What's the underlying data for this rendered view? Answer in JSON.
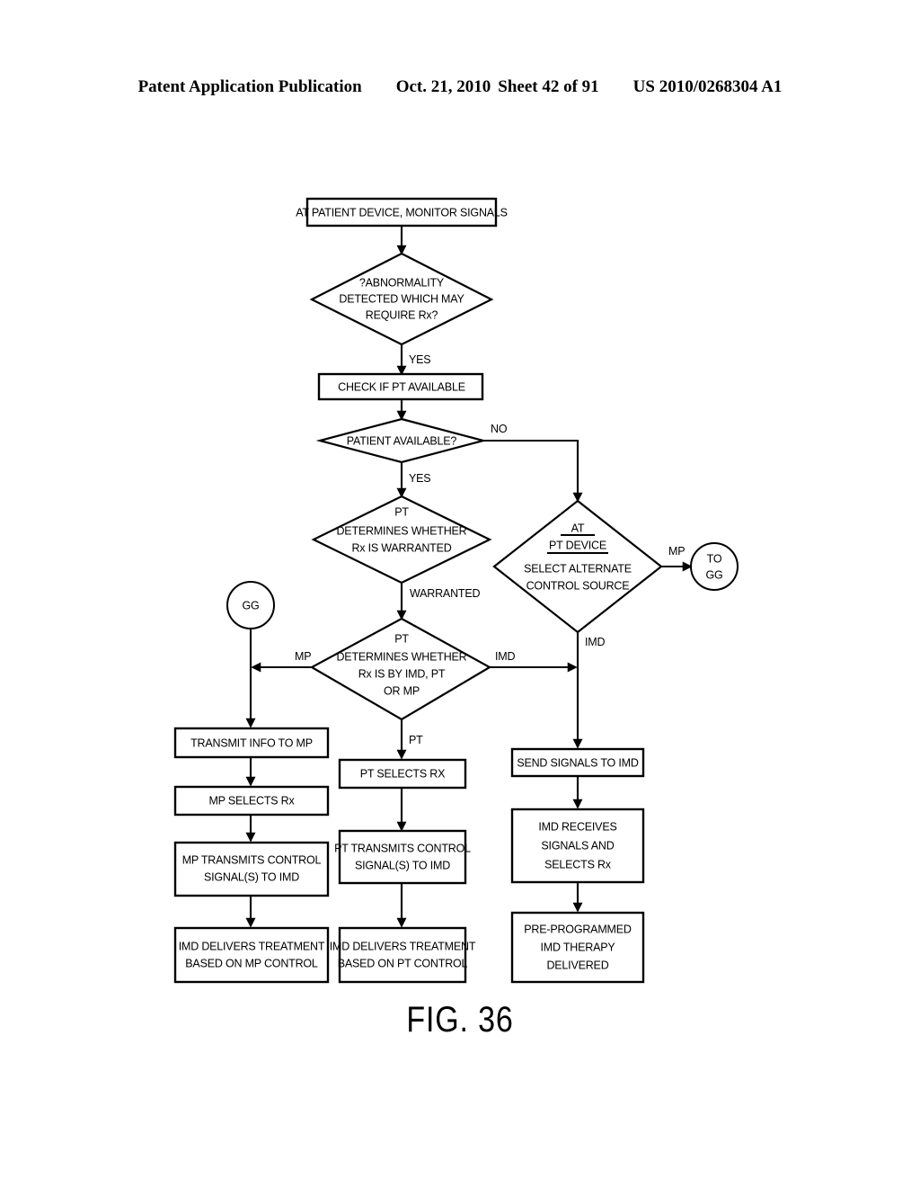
{
  "header": {
    "publication": "Patent Application Publication",
    "date": "Oct. 21, 2010",
    "sheet": "Sheet 42 of 91",
    "number": "US 2010/0268304 A1"
  },
  "figure": {
    "caption": "FIG. 36"
  },
  "flowchart": {
    "nodes": {
      "monitor": {
        "type": "process",
        "text": [
          "AT PATIENT DEVICE, MONITOR SIGNALS"
        ]
      },
      "abnormality": {
        "type": "decision",
        "text": [
          "?ABNORMALITY",
          "DETECTED WHICH MAY",
          "REQUIRE Rx?"
        ]
      },
      "check_pt": {
        "type": "process",
        "text": [
          "CHECK IF PT AVAILABLE"
        ]
      },
      "patient_available": {
        "type": "decision",
        "text": [
          "PATIENT AVAILABLE?"
        ]
      },
      "pt_warranted": {
        "type": "decision",
        "text": [
          "PT",
          "DETERMINES WHETHER",
          "Rx IS WARRANTED"
        ]
      },
      "alt_source": {
        "type": "decision",
        "text": [
          "AT",
          "PT DEVICE",
          "SELECT ALTERNATE",
          "CONTROL SOURCE"
        ],
        "underlined": [
          "AT",
          "PT DEVICE"
        ]
      },
      "to_gg": {
        "type": "connector",
        "text": [
          "TO",
          "GG"
        ]
      },
      "gg": {
        "type": "connector",
        "text": [
          "GG"
        ]
      },
      "route_rx": {
        "type": "decision",
        "text": [
          "PT",
          "DETERMINES WHETHER",
          "Rx IS BY IMD, PT",
          "OR MP"
        ]
      },
      "transmit_info_mp": {
        "type": "process",
        "text": [
          "TRANSMIT INFO TO MP"
        ]
      },
      "mp_selects": {
        "type": "process",
        "text": [
          "MP SELECTS Rx"
        ]
      },
      "mp_transmits": {
        "type": "process",
        "text": [
          "MP TRANSMITS CONTROL",
          "SIGNAL(S) TO IMD"
        ]
      },
      "imd_delivers_mp": {
        "type": "process",
        "text": [
          "IMD DELIVERS TREATMENT",
          "BASED ON MP CONTROL"
        ]
      },
      "pt_selects": {
        "type": "process",
        "text": [
          "PT SELECTS RX"
        ]
      },
      "pt_transmits": {
        "type": "process",
        "text": [
          "PT TRANSMITS CONTROL",
          "SIGNAL(S) TO IMD"
        ]
      },
      "imd_delivers_pt": {
        "type": "process",
        "text": [
          "IMD DELIVERS TREATMENT",
          "BASED ON PT CONTROL"
        ]
      },
      "send_signals_imd": {
        "type": "process",
        "text": [
          "SEND SIGNALS TO IMD"
        ]
      },
      "imd_receives": {
        "type": "process",
        "text": [
          "IMD RECEIVES",
          "SIGNALS AND",
          "SELECTS Rx"
        ]
      },
      "pre_programmed": {
        "type": "process",
        "text": [
          "PRE-PROGRAMMED",
          "IMD THERAPY",
          "DELIVERED"
        ]
      }
    },
    "edge_labels": {
      "abnormality_yes": "YES",
      "patient_yes": "YES",
      "patient_no": "NO",
      "warranted": "WARRANTED",
      "alt_mp": "MP",
      "alt_imd": "IMD",
      "route_mp": "MP",
      "route_pt": "PT",
      "route_imd": "IMD"
    }
  }
}
